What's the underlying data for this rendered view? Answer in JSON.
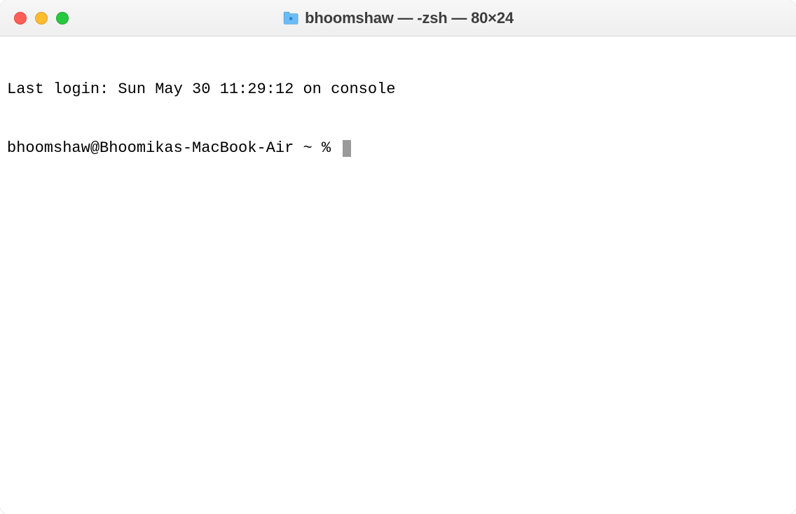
{
  "window": {
    "title": "bhoomshaw — -zsh — 80×24"
  },
  "terminal": {
    "last_login": "Last login: Sun May 30 11:29:12 on console",
    "prompt": "bhoomshaw@Bhoomikas-MacBook-Air ~ % "
  }
}
